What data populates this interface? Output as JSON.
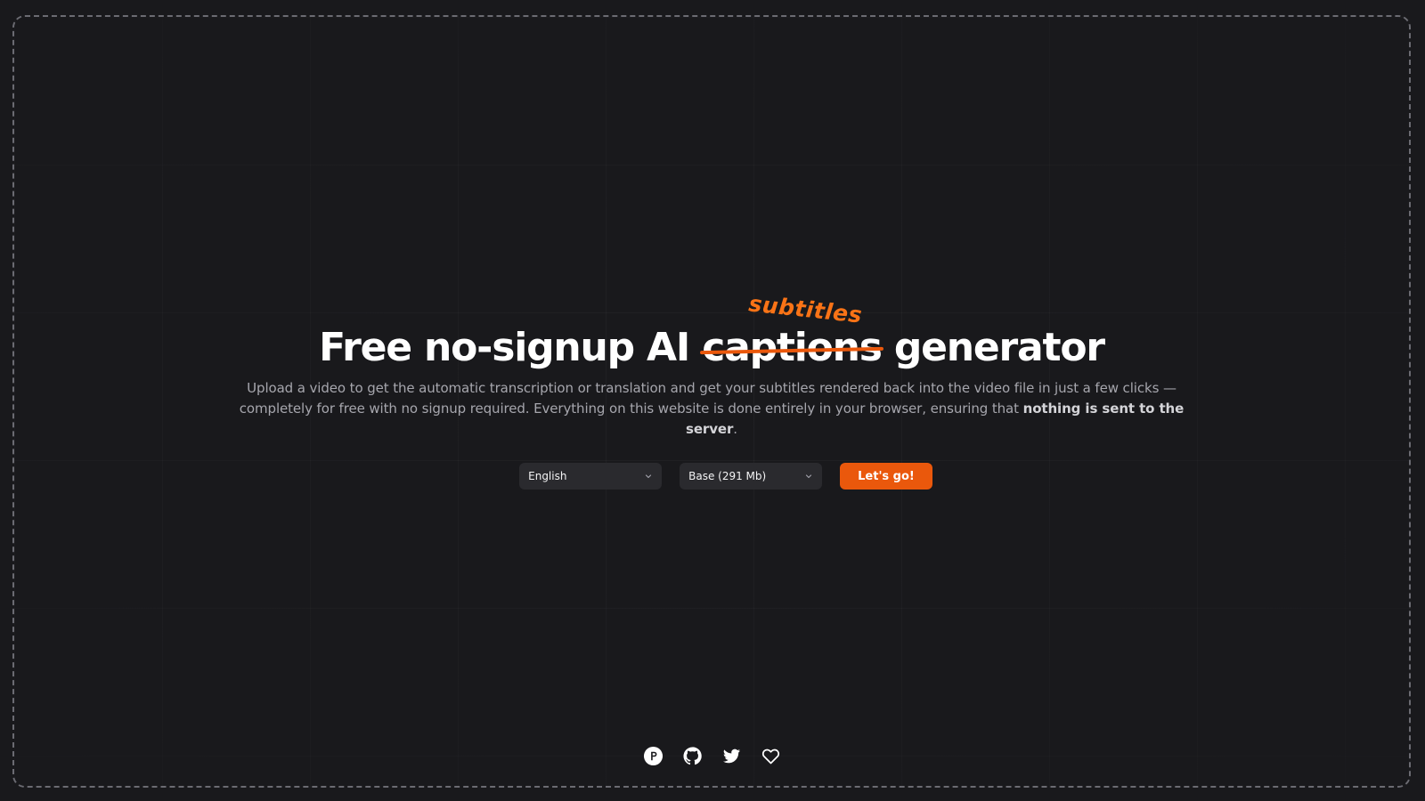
{
  "hero": {
    "title_before": "Free no-signup AI ",
    "title_struck": "captions",
    "title_replacement": "subtitles",
    "title_after": " generator",
    "description_part1": "Upload a video to get the automatic transcription or translation and get your subtitles rendered back into the video file in just a few clicks — completely for free with no signup required. Everything on this website is done entirely in your browser, ensuring that ",
    "description_bold": "nothing is sent to the server",
    "description_end": "."
  },
  "controls": {
    "language_value": "English",
    "model_value": "Base (291 Mb)",
    "submit_label": "Let's go!"
  },
  "footer": {
    "icons": [
      "product-hunt-icon",
      "github-icon",
      "twitter-icon",
      "heart-icon"
    ]
  },
  "colors": {
    "background": "#19191c",
    "accent": "#ea580c",
    "accent_text": "#f97316",
    "muted_text": "#a6a6ad",
    "select_bg": "#2a2a2e"
  }
}
